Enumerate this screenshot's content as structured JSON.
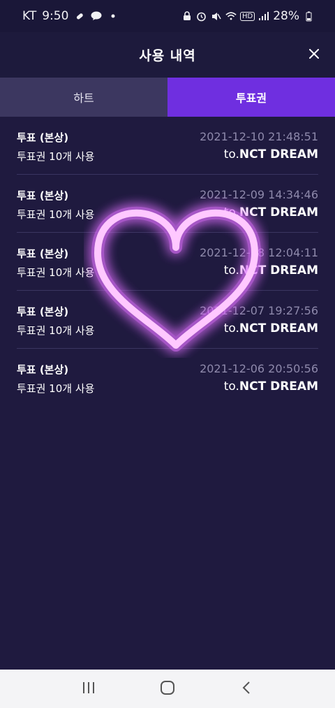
{
  "status_bar": {
    "carrier": "KT",
    "time": "9:50",
    "hd_label": "HD",
    "battery": "28%"
  },
  "header": {
    "title": "사용 내역"
  },
  "tabs": [
    {
      "label": "하트",
      "selected": false
    },
    {
      "label": "투표권",
      "selected": true
    }
  ],
  "history": [
    {
      "title": "투표 (본상)",
      "date": "2021-12-10 21:48:51",
      "desc": "투표권 10개 사용",
      "to_prefix": "to.",
      "artist": "NCT DREAM"
    },
    {
      "title": "투표 (본상)",
      "date": "2021-12-09 14:34:46",
      "desc": "투표권 10개 사용",
      "to_prefix": "to.",
      "artist": "NCT DREAM"
    },
    {
      "title": "투표 (본상)",
      "date": "2021-12-08 12:04:11",
      "desc": "투표권 10개 사용",
      "to_prefix": "to.",
      "artist": "NCT DREAM"
    },
    {
      "title": "투표 (본상)",
      "date": "2021-12-07 19:27:56",
      "desc": "투표권 10개 사용",
      "to_prefix": "to.",
      "artist": "NCT DREAM"
    },
    {
      "title": "투표 (본상)",
      "date": "2021-12-06 20:50:56",
      "desc": "투표권 10개 사용",
      "to_prefix": "to.",
      "artist": "NCT DREAM"
    }
  ],
  "colors": {
    "background": "#1f1a3f",
    "accent": "#6f2fe0",
    "heart_glow": "#e070ff"
  },
  "icons": {
    "close": "close-icon",
    "heart_overlay": "heart-icon",
    "nav": [
      "recent-apps-icon",
      "home-icon",
      "back-icon"
    ]
  }
}
